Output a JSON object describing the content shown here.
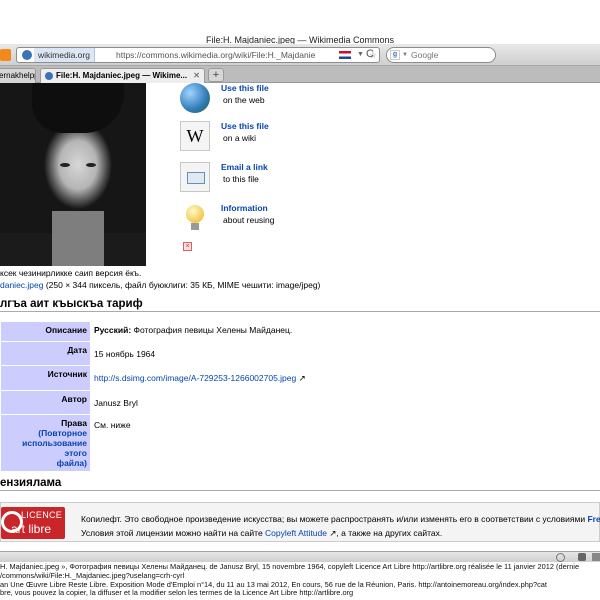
{
  "window": {
    "title": "File:H. Majdaniec.jpeg — Wikimedia Commons"
  },
  "toolbar": {
    "identity": "wikimedia.org",
    "url": "https://commons.wikimedia.org/wiki/File:H._Majdanie",
    "search_placeholder": "Google"
  },
  "tabs": [
    {
      "label": "ernakhelppt"
    },
    {
      "label": "File:H. Majdaniec.jpeg — Wikime..."
    }
  ],
  "reuse": [
    {
      "title": "Use this file",
      "sub": "on the web",
      "icon": "globe-icon"
    },
    {
      "title": "Use this file",
      "sub": "on a wiki",
      "icon": "wikipedia-icon"
    },
    {
      "title": "Email a link",
      "sub": "to this file",
      "icon": "email-icon"
    },
    {
      "title": "Information",
      "sub": "about reusing",
      "icon": "lightbulb-icon"
    }
  ],
  "caption": "ксек чезинирликке саип версия ёкъ.",
  "fileinfo": {
    "link": "daniec.jpeg",
    "rest": " (250 × 344 пиксель, файл буюклиги: 35 КБ, MIME чешити: image/jpeg)"
  },
  "section1": "лгъа аит къыскъа тариф",
  "summary": {
    "desc_label": "Описание",
    "desc_lang": "Русский:",
    "desc_value": " Фотография певицы Хелены Майданец.",
    "date_label": "Дата",
    "date_value": "15 ноябрь 1964",
    "source_label": "Источник",
    "source_value": "http://s.dsimg.com/image/A-729253-1266002705.jpeg",
    "author_label": "Автор",
    "author_value": "Janusz Bryl",
    "rights_label": "Права",
    "rights_link": "(Повторное",
    "rights_link2": "использование этого",
    "rights_link3": "файла)",
    "rights_value": "См. ниже"
  },
  "section2": "ензиялама",
  "license": {
    "logo_top": "LICENCE",
    "logo_bottom": "art libre",
    "line1": "Копилефт. Это свободное произведение искусства; вы можете распространять и/или изменять его в соответствии с условиями ",
    "line1_bold": "Free",
    "line2_a": "Условия этой лицензии можно найти на сайте ",
    "line2_link": "Copyleft Attitude",
    "line2_b": " ↗, а также на других сайтах."
  },
  "bottom_lines": [
    "H. Majdaniec.jpeg », Фотография певицы Хелены Майданец. de Janusz Bryl, 15 novembre 1964, copyleft Licence Art Libre http://artlibre.org réalisée le 11 janvier 2012 (dernie",
    "/commons/wiki/File:H._Majdaniec.jpeg?uselang=crh-cyrl",
    "an Une Œuvre Libre Reste Libre. Exposition Mode d'Emploi n°14, du 11 au 13 mai 2012, En cours, 56 rue de la Réunion, Paris. http://antoinemoreau.org/index.php?cat",
    "bre, vous pouvez la copier, la diffuser et la modifier selon les termes de la Licence Art Libre http://artlibre.org"
  ]
}
